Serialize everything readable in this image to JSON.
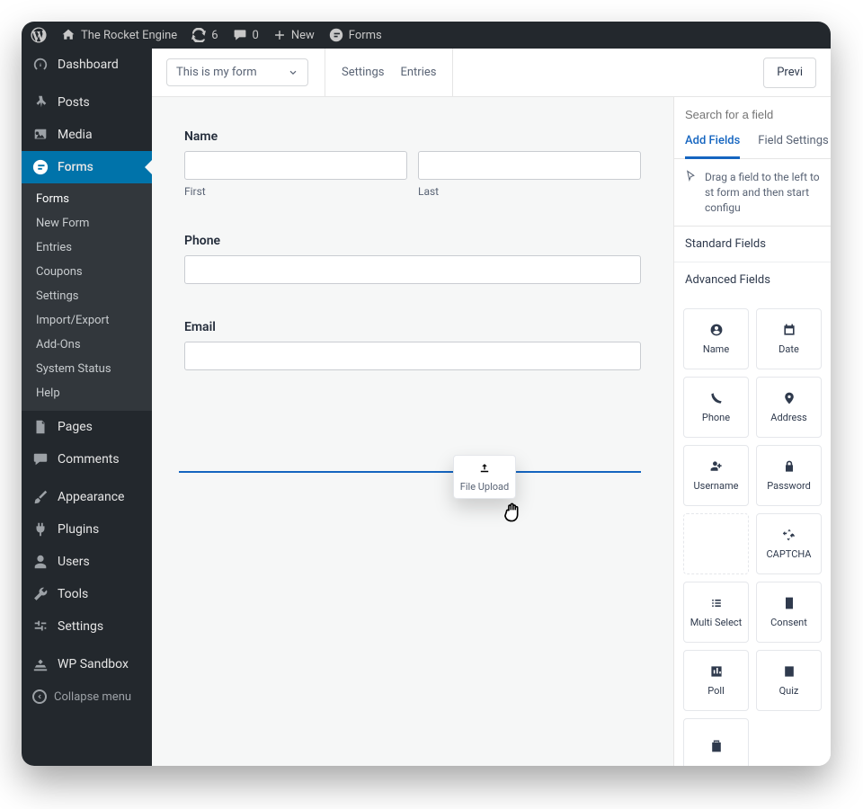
{
  "adminbar": {
    "site_name": "The Rocket Engine",
    "updates": "6",
    "comments": "0",
    "new": "New",
    "forms": "Forms"
  },
  "sidebar": {
    "items": [
      {
        "key": "dashboard",
        "label": "Dashboard"
      },
      {
        "key": "posts",
        "label": "Posts"
      },
      {
        "key": "media",
        "label": "Media"
      },
      {
        "key": "forms",
        "label": "Forms"
      },
      {
        "key": "pages",
        "label": "Pages"
      },
      {
        "key": "comments",
        "label": "Comments"
      },
      {
        "key": "appearance",
        "label": "Appearance"
      },
      {
        "key": "plugins",
        "label": "Plugins"
      },
      {
        "key": "users",
        "label": "Users"
      },
      {
        "key": "tools",
        "label": "Tools"
      },
      {
        "key": "settings",
        "label": "Settings"
      },
      {
        "key": "wpsandbox",
        "label": "WP Sandbox"
      }
    ],
    "forms_submenu": [
      "Forms",
      "New Form",
      "Entries",
      "Coupons",
      "Settings",
      "Import/Export",
      "Add-Ons",
      "System Status",
      "Help"
    ],
    "collapse": "Collapse menu"
  },
  "header": {
    "form_name": "This is my form",
    "settings": "Settings",
    "entries": "Entries",
    "preview": "Previ"
  },
  "form": {
    "name_label": "Name",
    "first_sub": "First",
    "last_sub": "Last",
    "phone_label": "Phone",
    "email_label": "Email"
  },
  "drag": {
    "chip_label": "File Upload"
  },
  "panel": {
    "search_placeholder": "Search for a field",
    "tab_add": "Add Fields",
    "tab_settings": "Field Settings",
    "hint": "Drag a field to the left to st form and then start configu",
    "standard": "Standard Fields",
    "advanced": "Advanced Fields",
    "fields": [
      {
        "key": "name",
        "label": "Name"
      },
      {
        "key": "date",
        "label": "Date"
      },
      {
        "key": "phone",
        "label": "Phone"
      },
      {
        "key": "address",
        "label": "Address"
      },
      {
        "key": "username",
        "label": "Username"
      },
      {
        "key": "password",
        "label": "Password"
      },
      {
        "key": "blank",
        "label": ""
      },
      {
        "key": "captcha",
        "label": "CAPTCHA"
      },
      {
        "key": "multiselect",
        "label": "Multi Select"
      },
      {
        "key": "consent",
        "label": "Consent"
      },
      {
        "key": "poll",
        "label": "Poll"
      },
      {
        "key": "quiz",
        "label": "Quiz"
      },
      {
        "key": "clipboard",
        "label": ""
      }
    ]
  }
}
